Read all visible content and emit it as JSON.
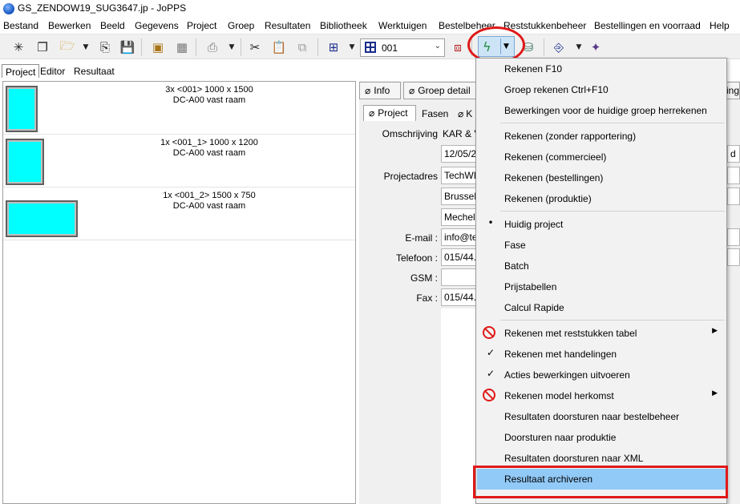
{
  "window": {
    "title": "GS_ZENDOW19_SUG3647.jp - JoPPS"
  },
  "menu": [
    "Bestand",
    "Bewerken",
    "Beeld",
    "Gegevens",
    "Project",
    "Groep",
    "Resultaten",
    "Bibliotheek",
    "Werktuigen",
    "Bestelbeheer",
    "Reststukkenbeheer",
    "Bestellingen en voorraad",
    "Help"
  ],
  "toolbar": {
    "combo_value": "001"
  },
  "left_tabs": [
    "Project",
    "Editor",
    "Resultaat"
  ],
  "items": [
    {
      "line1": "3x <001> 1000 x 1500",
      "line2": "DC-A00 vast raam"
    },
    {
      "line1": "1x <001_1> 1000 x 1200",
      "line2": "DC-A00 vast raam"
    },
    {
      "line1": "1x <001_2> 1500 x 750",
      "line2": "DC-A00 vast raam"
    }
  ],
  "right_tabs": {
    "info": "Info",
    "groep_detail": "Groep detail",
    "cut": "ing"
  },
  "sub_tabs": {
    "project": "Project",
    "fasen": "Fasen",
    "cut": "K"
  },
  "fields": {
    "omschrijving_label": "Omschrijving",
    "omschrijving_value": "KAR & V",
    "date_value": "12/05/2",
    "date_extra": "d",
    "projectadres_label": "Projectadres",
    "adres1": "TechWI",
    "adres2": "Brussels",
    "adres3": "Mechele",
    "email_label": "E-mail :",
    "email_value": "info@tec",
    "telefoon_label": "Telefoon :",
    "telefoon_value": "015/44.6",
    "gsm_label": "GSM :",
    "fax_label": "Fax :",
    "fax_value": "015/44.6"
  },
  "dropdown": [
    "Rekenen F10",
    "Groep rekenen Ctrl+F10",
    "Bewerkingen voor de huidige groep herrekenen",
    "Rekenen (zonder rapportering)",
    "Rekenen (commercieel)",
    "Rekenen (bestellingen)",
    "Rekenen (produktie)",
    "Huidig project",
    "Fase",
    "Batch",
    "Prijstabellen",
    "Calcul Rapide",
    "Rekenen met reststukken tabel",
    "Rekenen met handelingen",
    "Acties bewerkingen uitvoeren",
    "Rekenen model herkomst",
    "Resultaten doorsturen naar bestelbeheer",
    "Doorsturen naar produktie",
    "Resultaten doorsturen naar XML",
    "Resultaat archiveren"
  ],
  "colors": {
    "highlight": "#91c9f7",
    "annotation": "#e01919",
    "thumbnail": "#00ffff"
  }
}
